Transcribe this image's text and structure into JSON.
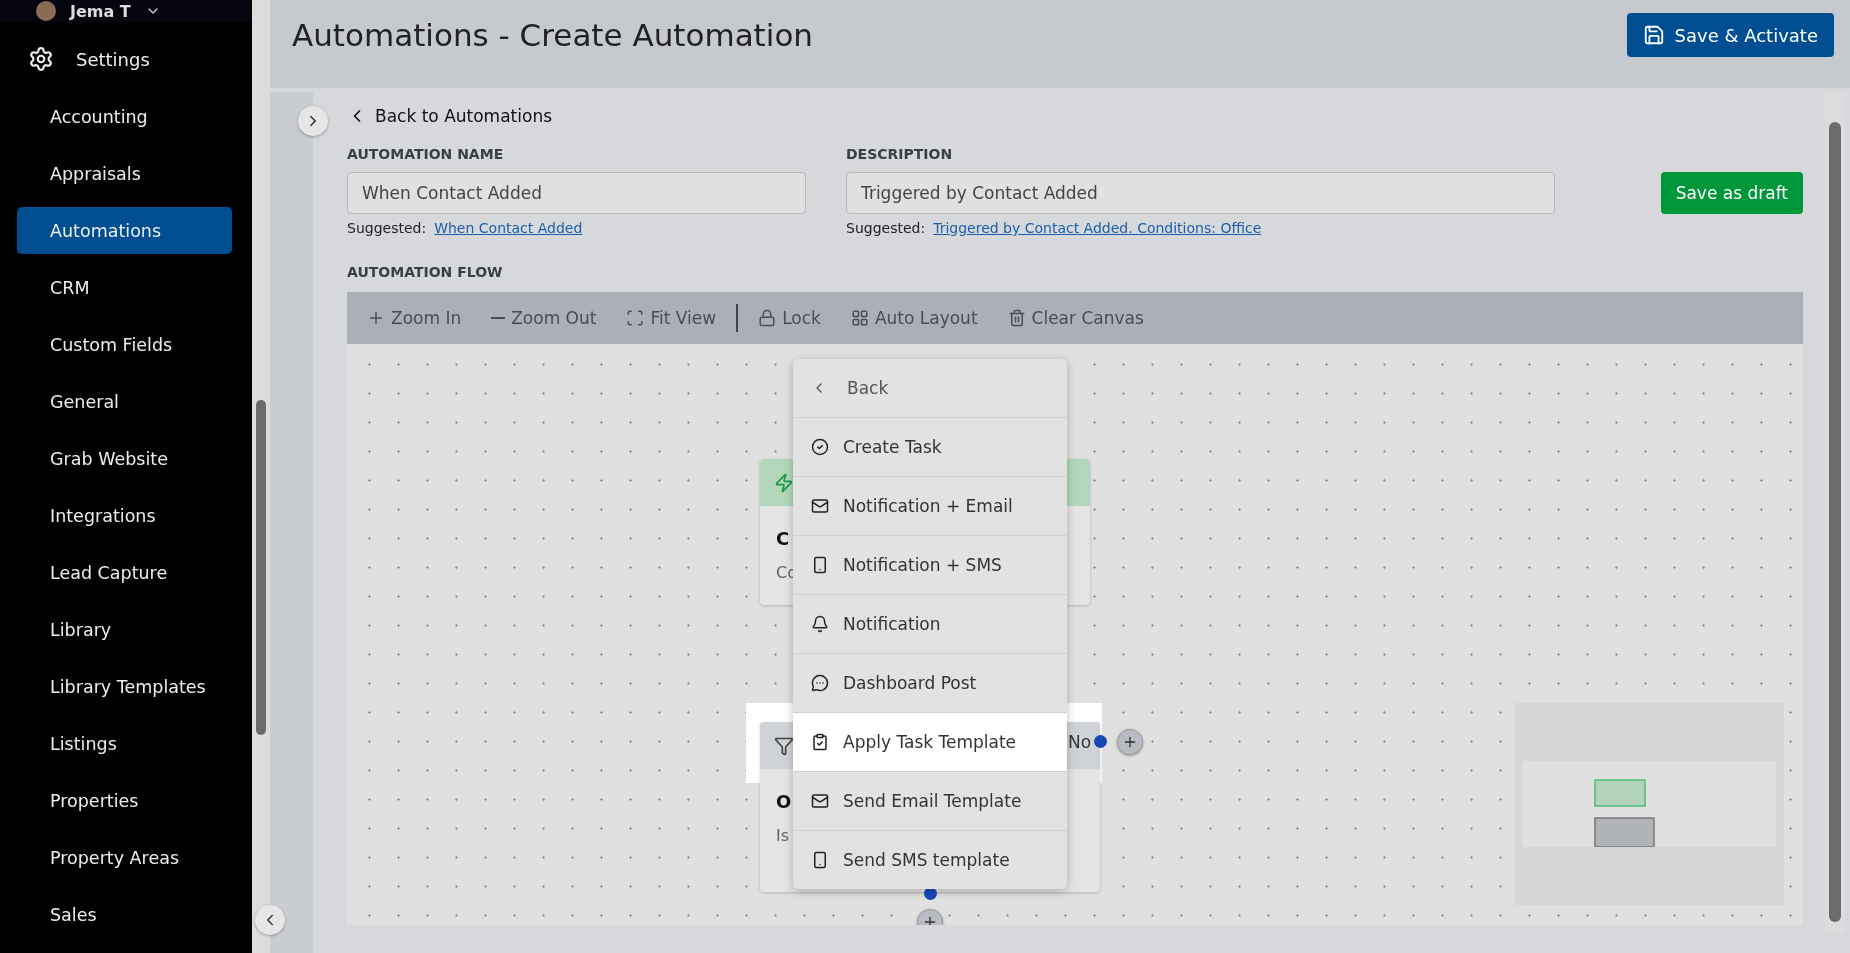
{
  "sidebar": {
    "user": {
      "name": "Jema T"
    },
    "section": {
      "label": "Settings"
    },
    "items": [
      {
        "label": "Accounting",
        "selected": false
      },
      {
        "label": "Appraisals",
        "selected": false
      },
      {
        "label": "Automations",
        "selected": true
      },
      {
        "label": "CRM",
        "selected": false
      },
      {
        "label": "Custom Fields",
        "selected": false
      },
      {
        "label": "General",
        "selected": false
      },
      {
        "label": "Grab Website",
        "selected": false
      },
      {
        "label": "Integrations",
        "selected": false
      },
      {
        "label": "Lead Capture",
        "selected": false
      },
      {
        "label": "Library",
        "selected": false
      },
      {
        "label": "Library Templates",
        "selected": false
      },
      {
        "label": "Listings",
        "selected": false
      },
      {
        "label": "Properties",
        "selected": false
      },
      {
        "label": "Property Areas",
        "selected": false
      },
      {
        "label": "Sales",
        "selected": false
      }
    ]
  },
  "header": {
    "title": "Automations - Create Automation",
    "save_button": "Save & Activate"
  },
  "back_link": "Back to Automations",
  "fields": [
    {
      "label": "AUTOMATION NAME",
      "value": "When Contact Added",
      "suggested_label": "Suggested:",
      "suggestion": "When Contact Added"
    },
    {
      "label": "DESCRIPTION",
      "value": "Triggered by Contact Added",
      "suggested_label": "Suggested:",
      "suggestion": "Triggered by Contact Added. Conditions: Office"
    }
  ],
  "draft_button": "Save as draft",
  "flow": {
    "label": "AUTOMATION FLOW",
    "toolbar": [
      {
        "kind": "zoom-in",
        "label": "Zoom In"
      },
      {
        "kind": "zoom-out",
        "label": "Zoom Out"
      },
      {
        "kind": "fit",
        "label": "Fit View"
      },
      {
        "kind": "separator"
      },
      {
        "kind": "lock",
        "label": "Lock"
      },
      {
        "kind": "layout",
        "label": "Auto Layout"
      },
      {
        "kind": "clear",
        "label": "Clear Canvas"
      }
    ],
    "nodes": [
      {
        "kind": "trigger",
        "title": "C",
        "subtitle": "Co"
      },
      {
        "kind": "condition",
        "title": "O",
        "subtitle": "Is",
        "branch_label": "No"
      }
    ],
    "menu": {
      "back": "Back",
      "items": [
        {
          "kind": "task",
          "label": "Create Task",
          "highlighted": false
        },
        {
          "kind": "mail",
          "label": "Notification + Email",
          "highlighted": false
        },
        {
          "kind": "sms",
          "label": "Notification + SMS",
          "highlighted": false
        },
        {
          "kind": "bell",
          "label": "Notification",
          "highlighted": false
        },
        {
          "kind": "post",
          "label": "Dashboard Post",
          "highlighted": false
        },
        {
          "kind": "template",
          "label": "Apply Task Template",
          "highlighted": true
        },
        {
          "kind": "mail",
          "label": "Send Email Template",
          "highlighted": false
        },
        {
          "kind": "sms",
          "label": "Send SMS template",
          "highlighted": false
        }
      ]
    }
  }
}
